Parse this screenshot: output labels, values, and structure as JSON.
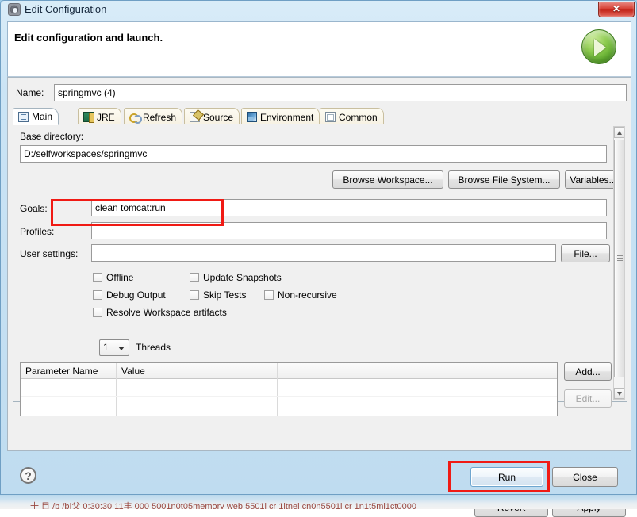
{
  "window": {
    "title": "Edit Configuration",
    "title_icon": "config-gear-icon",
    "close_label": "✕"
  },
  "header": {
    "title": "Edit configuration and launch.",
    "run_glyph_icon": "green-run-play-icon"
  },
  "name_field": {
    "label": "Name:",
    "value": "springmvc (4)"
  },
  "tabs": [
    {
      "label": "Main",
      "icon": "main-document-icon",
      "active": true
    },
    {
      "label": "JRE",
      "icon": "jre-library-icon",
      "active": false
    },
    {
      "label": "Refresh",
      "icon": "refresh-arrows-icon",
      "active": false
    },
    {
      "label": "Source",
      "icon": "source-pencil-icon",
      "active": false
    },
    {
      "label": "Environment",
      "icon": "environment-icon",
      "active": false
    },
    {
      "label": "Common",
      "icon": "common-window-icon",
      "active": false
    }
  ],
  "main_tab": {
    "base_directory": {
      "label": "Base directory:",
      "value": "D:/selfworkspaces/springmvc"
    },
    "browse_buttons": [
      {
        "label": "Browse Workspace..."
      },
      {
        "label": "Browse File System..."
      },
      {
        "label": "Variables..."
      }
    ],
    "goals": {
      "label": "Goals:",
      "value": "clean tomcat:run",
      "highlighted": true
    },
    "profiles": {
      "label": "Profiles:",
      "value": ""
    },
    "user_settings": {
      "label": "User settings:",
      "value": "",
      "button_label": "File..."
    },
    "checkboxes": [
      {
        "label": "Offline",
        "checked": false
      },
      {
        "label": "Update Snapshots",
        "checked": false
      },
      {
        "label": "Debug Output",
        "checked": false
      },
      {
        "label": "Skip Tests",
        "checked": false
      },
      {
        "label": "Non-recursive",
        "checked": false
      },
      {
        "label": "Resolve Workspace artifacts",
        "checked": false
      }
    ],
    "threads": {
      "value": "1",
      "label": "Threads"
    },
    "parameter_table": {
      "columns": [
        "Parameter Name",
        "Value",
        ""
      ],
      "rows": [],
      "buttons": [
        {
          "label": "Add...",
          "enabled": true
        },
        {
          "label": "Edit...",
          "enabled": false
        }
      ]
    }
  },
  "footer": {
    "revert_label": "Revert",
    "apply_label": "Apply",
    "help_icon": "question-mark-help-icon",
    "help_glyph": "?",
    "run_label": "Run",
    "close_label": "Close",
    "run_highlighted": true
  },
  "console_strip": {
    "text": "十 目 /b   /b|父 0:30:30  11丰 000 5001n0t05memory  web 5501l cr  1ltnel cn0n5501l cr  1n1t5ml1ct0000"
  },
  "colors": {
    "annotation_red": "#f01a14",
    "title_bar_blue": "#9ecbe8",
    "close_button_red": "#c01f14",
    "run_glyph_green": "#5aa72b",
    "default_button_focus": "#6fa6cf"
  }
}
